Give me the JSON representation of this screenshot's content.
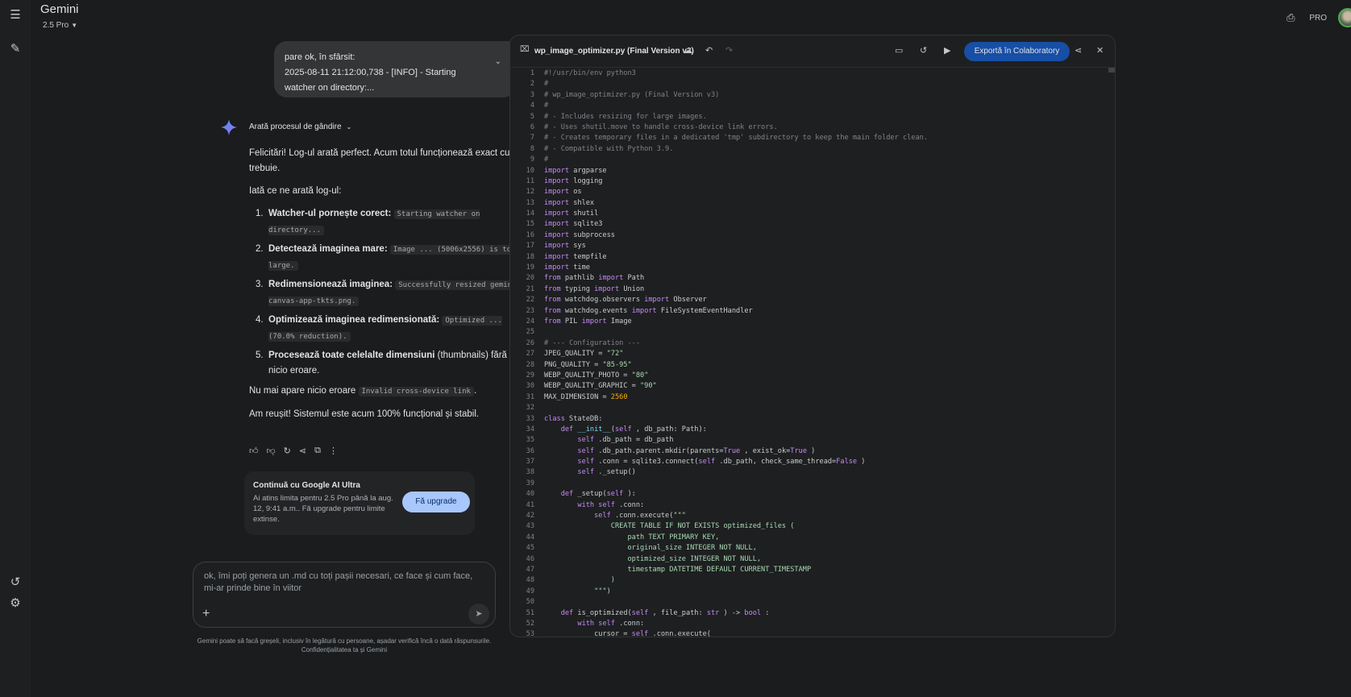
{
  "app": {
    "title": "Gemini",
    "model": "2.5 Pro",
    "badge": "PRO"
  },
  "icons": {
    "menu": "menu-icon",
    "new_chat": "new-chat-icon",
    "history": "history-icon",
    "settings": "gear-icon",
    "print": "print-icon"
  },
  "user_message": {
    "line1": "pare ok, în sfârsit:",
    "line2": "2025-08-11 21:12:00,738 - [INFO] - Starting",
    "line3": "watcher on directory:..."
  },
  "thinking_label": "Arată procesul de gândire",
  "answer": {
    "intro": "Felicitări! Log-ul arată perfect. Acum totul funcționează exact cum trebuie.",
    "lead": "Iată ce ne arată log-ul:",
    "items": [
      {
        "num": "1.",
        "bold": "Watcher-ul pornește corect:",
        "code": "Starting watcher on directory...",
        "tail": ""
      },
      {
        "num": "2.",
        "bold": "Detectează imaginea mare:",
        "code": "Image ... (5006x2556) is too large.",
        "tail": ""
      },
      {
        "num": "3.",
        "bold": "Redimensionează imaginea:",
        "code": "Successfully resized gemini-canvas-app-tkts.png.",
        "tail": ""
      },
      {
        "num": "4.",
        "bold": "Optimizează imaginea redimensionată:",
        "code": "Optimized ... (70.0% reduction).",
        "tail": ""
      },
      {
        "num": "5.",
        "bold": "Procesează toate celelalte dimensiuni",
        "code": "",
        "tail": " (thumbnails) fără nicio eroare."
      }
    ],
    "no_error_prefix": "Nu mai apare nicio eroare ",
    "no_error_code": "Invalid cross-device link",
    "no_error_suffix": ".",
    "outro": "Am reușit! Sistemul este acum 100% funcțional și stabil."
  },
  "upsell": {
    "title": "Continuă cu Google AI Ultra",
    "desc": "Ai atins limita pentru 2.5 Pro până la aug. 12, 9:41 a.m.. Fă upgrade pentru limite extinse.",
    "button": "Fă upgrade"
  },
  "input": {
    "placeholder": "ok, îmi poți genera un .md cu toți pașii necesari, ce face și cum face, mi-ar prinde bine în viitor"
  },
  "disclaimer": {
    "line1": "Gemini poate să facă greșeli, inclusiv în legătură cu persoane, așadar verifică încă o dată răspunsurile.",
    "line2": "Confidențialitatea ta și Gemini"
  },
  "canvas": {
    "filename": "wp_image_optimizer.py (Final Version v3)",
    "export_label": "Exportă în Colaboratory",
    "code_lines": [
      [
        [
          "cm",
          "#!/usr/bin/env python3"
        ]
      ],
      [
        [
          "cm",
          "#"
        ]
      ],
      [
        [
          "cm",
          "# wp_image_optimizer.py (Final Version v3)"
        ]
      ],
      [
        [
          "cm",
          "#"
        ]
      ],
      [
        [
          "cm",
          "# - Includes resizing for large images."
        ]
      ],
      [
        [
          "cm",
          "# - Uses shutil.move to handle cross-device link errors."
        ]
      ],
      [
        [
          "cm",
          "# - Creates temporary files in a dedicated 'tmp' subdirectory to keep the main folder clean."
        ]
      ],
      [
        [
          "cm",
          "# - Compatible with Python 3.9."
        ]
      ],
      [
        [
          "cm",
          "#"
        ]
      ],
      [
        [
          "kw",
          "import"
        ],
        [
          "",
          "argparse"
        ]
      ],
      [
        [
          "kw",
          "import"
        ],
        [
          "",
          "logging"
        ]
      ],
      [
        [
          "kw",
          "import"
        ],
        [
          "",
          "os"
        ]
      ],
      [
        [
          "kw",
          "import"
        ],
        [
          "",
          "shlex"
        ]
      ],
      [
        [
          "kw",
          "import"
        ],
        [
          "",
          "shutil"
        ]
      ],
      [
        [
          "kw",
          "import"
        ],
        [
          "",
          "sqlite3"
        ]
      ],
      [
        [
          "kw",
          "import"
        ],
        [
          "",
          "subprocess"
        ]
      ],
      [
        [
          "kw",
          "import"
        ],
        [
          "",
          "sys"
        ]
      ],
      [
        [
          "kw",
          "import"
        ],
        [
          "",
          "tempfile"
        ]
      ],
      [
        [
          "kw",
          "import"
        ],
        [
          "",
          "time"
        ]
      ],
      [
        [
          "kw",
          "from"
        ],
        [
          "",
          "pathlib "
        ],
        [
          "kw",
          "import"
        ],
        [
          "",
          "Path"
        ]
      ],
      [
        [
          "kw",
          "from"
        ],
        [
          "",
          "typing "
        ],
        [
          "kw",
          "import"
        ],
        [
          "",
          "Union"
        ]
      ],
      [
        [
          "kw",
          "from"
        ],
        [
          "",
          "watchdog.observers "
        ],
        [
          "kw",
          "import"
        ],
        [
          "",
          "Observer"
        ]
      ],
      [
        [
          "kw",
          "from"
        ],
        [
          "",
          "watchdog.events "
        ],
        [
          "kw",
          "import"
        ],
        [
          "",
          "FileSystemEventHandler"
        ]
      ],
      [
        [
          "kw",
          "from"
        ],
        [
          "",
          "PIL "
        ],
        [
          "kw",
          "import"
        ],
        [
          "",
          "Image"
        ]
      ],
      [],
      [
        [
          "cm",
          "# --- Configuration ---"
        ]
      ],
      [
        [
          "",
          "JPEG_QUALITY = "
        ],
        [
          "st",
          "\"72\""
        ]
      ],
      [
        [
          "",
          "PNG_QUALITY = "
        ],
        [
          "st",
          "\"85-95\""
        ]
      ],
      [
        [
          "",
          "WEBP_QUALITY_PHOTO = "
        ],
        [
          "st",
          "\"80\""
        ]
      ],
      [
        [
          "",
          "WEBP_QUALITY_GRAPHIC = "
        ],
        [
          "st",
          "\"90\""
        ]
      ],
      [
        [
          "",
          "MAX_DIMENSION = "
        ],
        [
          "nu",
          "2560"
        ]
      ],
      [],
      [
        [
          "kw",
          "class"
        ],
        [
          "",
          "StateDB:"
        ]
      ],
      [
        [
          "",
          "    "
        ],
        [
          "kw",
          "def"
        ],
        [
          "sb",
          "__init__"
        ],
        [
          "",
          "("
        ],
        [
          "kw",
          "self"
        ],
        [
          "",
          ", db_path: Path):"
        ]
      ],
      [
        [
          "",
          "        "
        ],
        [
          "kw",
          "self"
        ],
        [
          "",
          ".db_path = db_path"
        ]
      ],
      [
        [
          "",
          "        "
        ],
        [
          "kw",
          "self"
        ],
        [
          "",
          ".db_path.parent.mkdir(parents="
        ],
        [
          "kw",
          "True"
        ],
        [
          "",
          ", exist_ok="
        ],
        [
          "kw",
          "True"
        ],
        [
          "",
          ")"
        ]
      ],
      [
        [
          "",
          "        "
        ],
        [
          "kw",
          "self"
        ],
        [
          "",
          ".conn = sqlite3.connect("
        ],
        [
          "kw",
          "self"
        ],
        [
          "",
          ".db_path, check_same_thread="
        ],
        [
          "kw",
          "False"
        ],
        [
          "",
          ")"
        ]
      ],
      [
        [
          "",
          "        "
        ],
        [
          "kw",
          "self"
        ],
        [
          "",
          "._setup()"
        ]
      ],
      [],
      [
        [
          "",
          "    "
        ],
        [
          "kw",
          "def"
        ],
        [
          "",
          "_setup("
        ],
        [
          "kw",
          "self"
        ],
        [
          "",
          "):"
        ]
      ],
      [
        [
          "",
          "        "
        ],
        [
          "kw",
          "with"
        ],
        [
          "kw",
          "self"
        ],
        [
          "",
          ".conn:"
        ]
      ],
      [
        [
          "",
          "            "
        ],
        [
          "kw",
          "self"
        ],
        [
          "",
          ".conn.execute("
        ],
        [
          "st",
          "\"\"\""
        ]
      ],
      [
        [
          "st",
          "                CREATE TABLE IF NOT EXISTS optimized_files ("
        ]
      ],
      [
        [
          "st",
          "                    path TEXT PRIMARY KEY,"
        ]
      ],
      [
        [
          "st",
          "                    original_size INTEGER NOT NULL,"
        ]
      ],
      [
        [
          "st",
          "                    optimized_size INTEGER NOT NULL,"
        ]
      ],
      [
        [
          "st",
          "                    timestamp DATETIME DEFAULT CURRENT_TIMESTAMP"
        ]
      ],
      [
        [
          "st",
          "                )"
        ]
      ],
      [
        [
          "st",
          "            \"\"\""
        ],
        [
          "",
          ")"
        ]
      ],
      [],
      [
        [
          "",
          "    "
        ],
        [
          "kw",
          "def"
        ],
        [
          "",
          "is_optimized("
        ],
        [
          "kw",
          "self"
        ],
        [
          "",
          ", file_path: "
        ],
        [
          "kw",
          "str"
        ],
        [
          "",
          ") -> "
        ],
        [
          "kw",
          "bool"
        ],
        [
          "",
          ":"
        ]
      ],
      [
        [
          "",
          "        "
        ],
        [
          "kw",
          "with"
        ],
        [
          "kw",
          "self"
        ],
        [
          "",
          ".conn:"
        ]
      ],
      [
        [
          "",
          "            cursor = "
        ],
        [
          "kw",
          "self"
        ],
        [
          "",
          ".conn.execute("
        ]
      ]
    ]
  }
}
